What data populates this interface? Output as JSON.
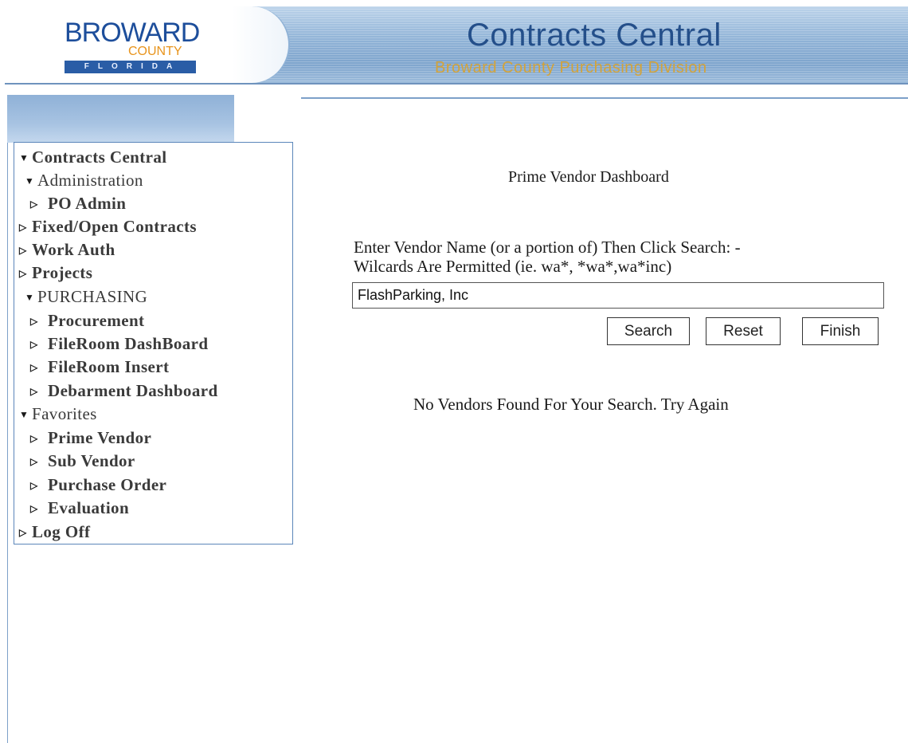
{
  "header": {
    "logo": {
      "word": "BROWARD",
      "county": "COUNTY",
      "state": "FLORIDA"
    },
    "title": "Contracts Central",
    "subtitle": "Broward County Purchasing Division"
  },
  "sidebar": {
    "items": [
      {
        "label": "Contracts Central",
        "glyph": "▼"
      },
      {
        "label": "Administration",
        "glyph": "▼"
      },
      {
        "label": "PO Admin",
        "glyph": "▷"
      },
      {
        "label": "Fixed/Open Contracts",
        "glyph": "▷"
      },
      {
        "label": "Work Auth",
        "glyph": "▷"
      },
      {
        "label": "Projects",
        "glyph": "▷"
      },
      {
        "label": "PURCHASING",
        "glyph": "▼"
      },
      {
        "label": "Procurement",
        "glyph": "▷"
      },
      {
        "label": "FileRoom DashBoard",
        "glyph": "▷"
      },
      {
        "label": "FileRoom Insert",
        "glyph": "▷"
      },
      {
        "label": "Debarment Dashboard",
        "glyph": "▷"
      },
      {
        "label": "Favorites",
        "glyph": "▼"
      },
      {
        "label": "Prime Vendor",
        "glyph": "▷"
      },
      {
        "label": "Sub Vendor",
        "glyph": "▷"
      },
      {
        "label": "Purchase Order",
        "glyph": "▷"
      },
      {
        "label": "Evaluation",
        "glyph": "▷"
      },
      {
        "label": "Log Off",
        "glyph": "▷"
      }
    ]
  },
  "main": {
    "title": "Prime Vendor Dashboard",
    "instruction_line1": "Enter Vendor Name (or a portion of) Then Click Search: -",
    "instruction_line2": "Wilcards Are Permitted (ie. wa*, *wa*,wa*inc)",
    "vendor_input_value": "FlashParking, Inc",
    "buttons": {
      "search": "Search",
      "reset": "Reset",
      "finish": "Finish"
    },
    "result_message": "No Vendors Found For Your Search. Try Again"
  },
  "colors": {
    "banner_blue": "#8fb2d6",
    "title_blue": "#244f8a",
    "subtitle_gold": "#d3a33a",
    "border_blue": "#5b86ba"
  }
}
